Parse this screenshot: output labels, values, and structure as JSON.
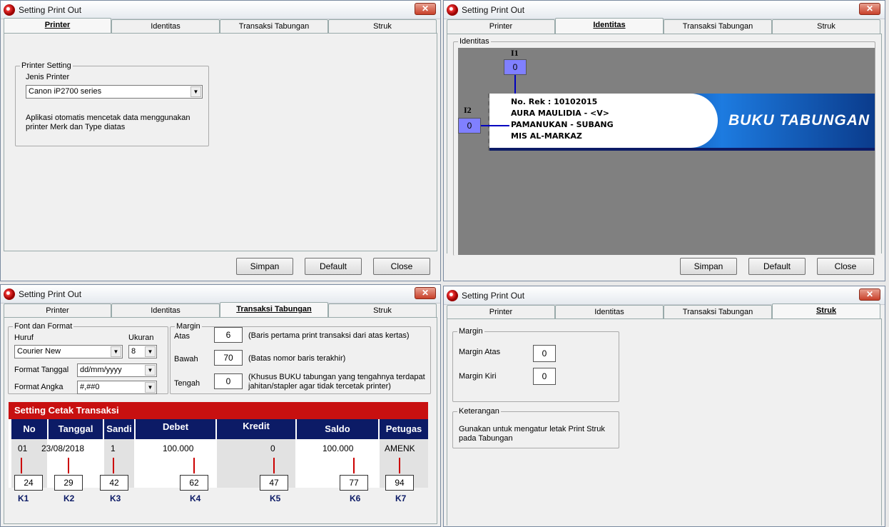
{
  "window_title": "Setting Print Out",
  "close_glyph": "✕",
  "tabs": [
    "Printer",
    "Identitas",
    "Transaksi Tabungan",
    "Struk"
  ],
  "buttons": {
    "simpan": "Simpan",
    "default": "Default",
    "close": "Close"
  },
  "printer": {
    "group": "Printer Setting",
    "label": "Jenis Printer",
    "value": "Canon iP2700 series",
    "note1": "Aplikasi otomatis mencetak data menggunakan",
    "note2": "printer Merk dan Type diatas"
  },
  "identitas": {
    "group": "Identitas",
    "i1_label": "I1",
    "i1_value": "0",
    "i2_label": "I2",
    "i2_value": "0",
    "lines": [
      "No. Rek : 10102015",
      "AURA MAULIDIA - <V>",
      "PAMANUKAN - SUBANG",
      "MIS AL-MARKAZ"
    ],
    "banner": "BUKU TABUNGAN"
  },
  "transaksi": {
    "font_group": "Font dan Format",
    "huruf_label": "Huruf",
    "huruf": "Courier New",
    "ukuran_label": "Ukuran",
    "ukuran": "8",
    "tgl_label": "Format Tanggal",
    "tgl": "dd/mm/yyyy",
    "angka_label": "Format Angka",
    "angka": "#,##0",
    "margin_group": "Margin",
    "atas_label": "Atas",
    "atas": "6",
    "atas_note": "(Baris pertama print transaksi dari atas kertas)",
    "bawah_label": "Bawah",
    "bawah": "70",
    "bawah_note": "(Batas nomor baris terakhir)",
    "tengah_label": "Tengah",
    "tengah": "0",
    "tengah_note1": "(Khusus BUKU tabungan yang tengahnya terdapat",
    "tengah_note2": "jahitan/stapler agar tidak tercetak printer)",
    "banner": "Setting Cetak Transaksi",
    "headers": [
      "No",
      "Tanggal",
      "Sandi",
      "Debet",
      "Kredit",
      "Saldo",
      "Petugas"
    ],
    "row": [
      "01",
      "23/08/2018",
      "1",
      "100.000",
      "0",
      "100.000",
      "AMENK"
    ],
    "kvals": [
      "24",
      "29",
      "42",
      "62",
      "47",
      "77",
      "94"
    ],
    "klabels": [
      "K1",
      "K2",
      "K3",
      "K4",
      "K5",
      "K6",
      "K7"
    ]
  },
  "struk": {
    "margin_group": "Margin",
    "atas_label": "Margin Atas",
    "atas": "0",
    "kiri_label": "Margin Kiri",
    "kiri": "0",
    "ket_group": "Keterangan",
    "ket1": "Gunakan untuk mengatur letak Print Struk",
    "ket2": "pada Tabungan"
  }
}
